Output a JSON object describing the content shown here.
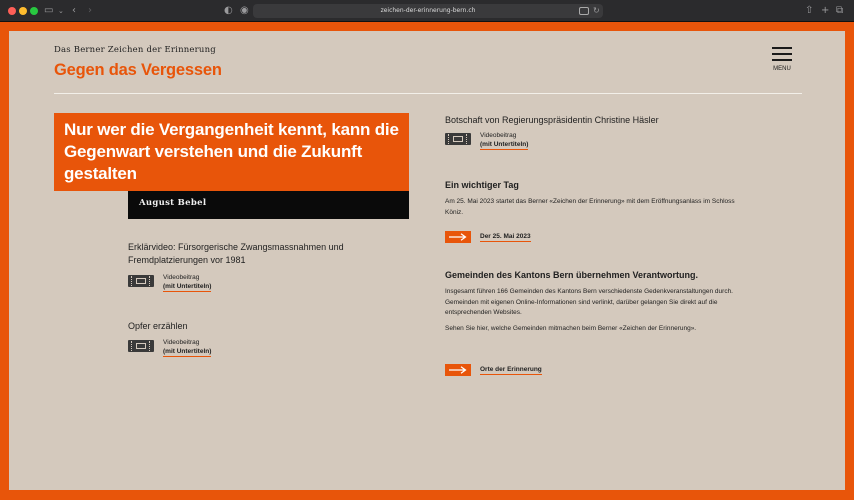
{
  "browser": {
    "url": "zeichen-der-erinnerung-bern.ch"
  },
  "header": {
    "kicker": "Das Berner Zeichen der Erinnerung",
    "title": "Gegen das Vergessen",
    "menu_label": "MENU"
  },
  "quote": {
    "text": "Nur wer die Vergangenheit kennt, kann die Gegenwart verstehen und die Zukunft gestalten",
    "author": "August Bebel"
  },
  "left": {
    "items": [
      {
        "title": "Erklärvideo: Fürsorgerische Zwangsmassnahmen und Fremdplatzierungen vor 1981",
        "kind": "Videobeitrag",
        "sub": "(mit Untertiteln)"
      },
      {
        "title": "Opfer erzählen",
        "kind": "Videobeitrag",
        "sub": "(mit Untertiteln)"
      }
    ]
  },
  "right": {
    "message": {
      "title": "Botschaft von Regierungspräsidentin Christine Häsler",
      "kind": "Videobeitrag",
      "sub": "(mit Untertiteln)"
    },
    "day": {
      "title": "Ein wichtiger Tag",
      "text": "Am 25. Mai 2023 startet das Berner «Zeichen der Erinnerung» mit dem Eröffnungsanlass im Schloss Köniz.",
      "link": "Der 25. Mai 2023"
    },
    "communities": {
      "title": "Gemeinden des Kantons Bern übernehmen Verantwortung.",
      "text1": "Insgesamt führen 166 Gemeinden des Kantons Bern verschiedenste Gedenkveranstaltungen durch. Gemeinden mit eigenen Online-Informationen sind verlinkt, darüber gelangen Sie direkt auf die entsprechenden Websites.",
      "text2": "Sehen Sie hier, welche Gemeinden mitmachen beim Berner «Zeichen der Erinnerung».",
      "link": "Orte der Erinnerung"
    }
  },
  "colors": {
    "accent": "#e8550a",
    "background": "#d4c9bd",
    "dark": "#0a0a0a"
  }
}
